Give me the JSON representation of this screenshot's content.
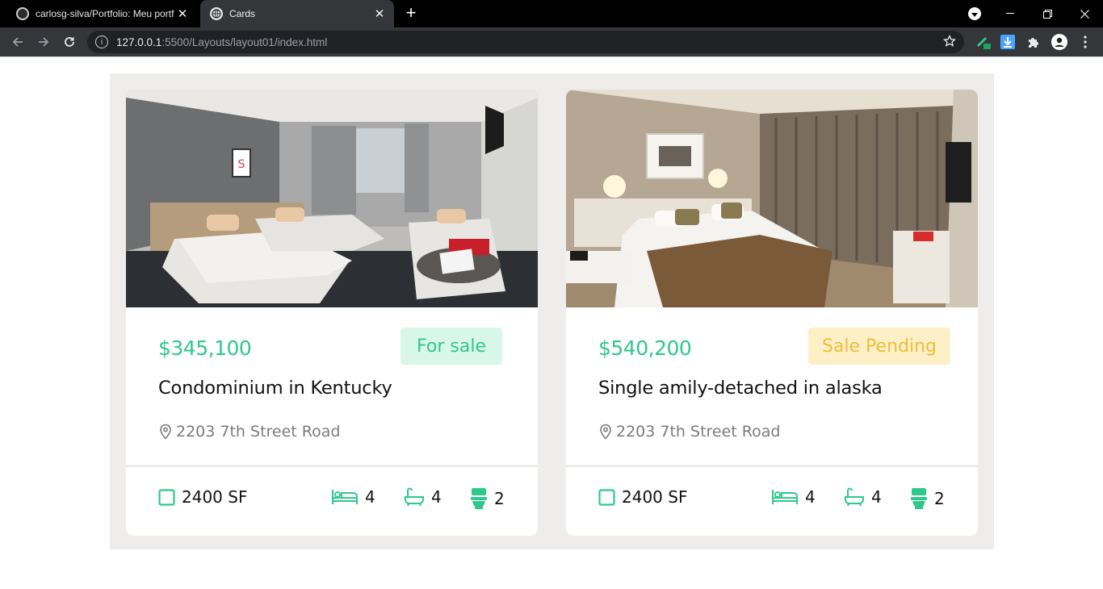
{
  "browser": {
    "tabs": [
      {
        "title": "carlosg-silva/Portfolio: Meu portfólio",
        "active": false
      },
      {
        "title": "Cards",
        "active": true
      }
    ],
    "url_host": "127.0.0.1",
    "url_path": ":5500/Layouts/layout01/index.html"
  },
  "colors": {
    "accent": "#2fc88c",
    "pending": "#efbd3a",
    "container_bg": "#eeedeb"
  },
  "cards": [
    {
      "price": "$345,100",
      "status": "For sale",
      "status_type": "sale",
      "title": "Condominium in Kentucky",
      "address": "2203 7th Street Road",
      "area": "2400 SF",
      "beds": "4",
      "baths": "4",
      "toilets": "2",
      "image": "hotel-room-two-beds"
    },
    {
      "price": "$540,200",
      "status": "Sale Pending",
      "status_type": "pending",
      "title": "Single amily-detached in alaska",
      "address": "2203 7th Street Road",
      "area": "2400 SF",
      "beds": "4",
      "baths": "4",
      "toilets": "2",
      "image": "hotel-room-king-bed"
    }
  ]
}
